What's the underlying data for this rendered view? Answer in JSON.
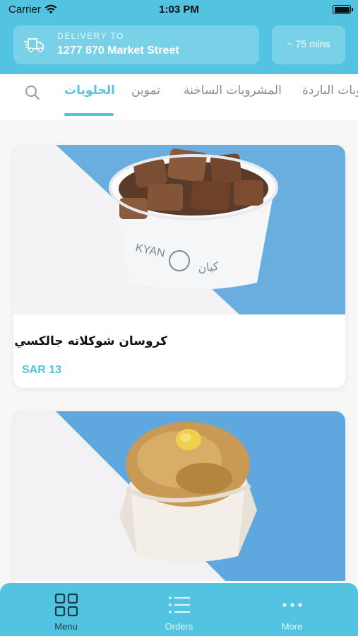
{
  "status_bar": {
    "carrier": "Carrier",
    "time": "1:03 PM"
  },
  "header": {
    "delivery_label": "DELIVERY TO",
    "delivery_address": "1277 870 Market Street",
    "eta": "~ 75 mins"
  },
  "categories": {
    "items": [
      {
        "label": "الحلويات",
        "active": true
      },
      {
        "label": "تموين",
        "active": false
      },
      {
        "label": "المشروبات الساخنة",
        "active": false
      },
      {
        "label": "المشروبات الباردة",
        "active": false
      }
    ]
  },
  "products": [
    {
      "name": "كروسان شوكلاته جالكسي",
      "price": "SAR 13",
      "cup_brand_latin": "KYAN",
      "cup_brand_arabic": "كيان"
    },
    {
      "name": "",
      "price": ""
    }
  ],
  "bottom_nav": {
    "items": [
      {
        "label": "Menu",
        "icon": "grid-icon",
        "active": true
      },
      {
        "label": "Orders",
        "icon": "list-icon",
        "active": false
      },
      {
        "label": "More",
        "icon": "more-dots-icon",
        "active": false
      }
    ]
  },
  "colors": {
    "brand": "#52c4e1",
    "card_background": "#ffffff",
    "page_background": "#f7f7f7"
  }
}
